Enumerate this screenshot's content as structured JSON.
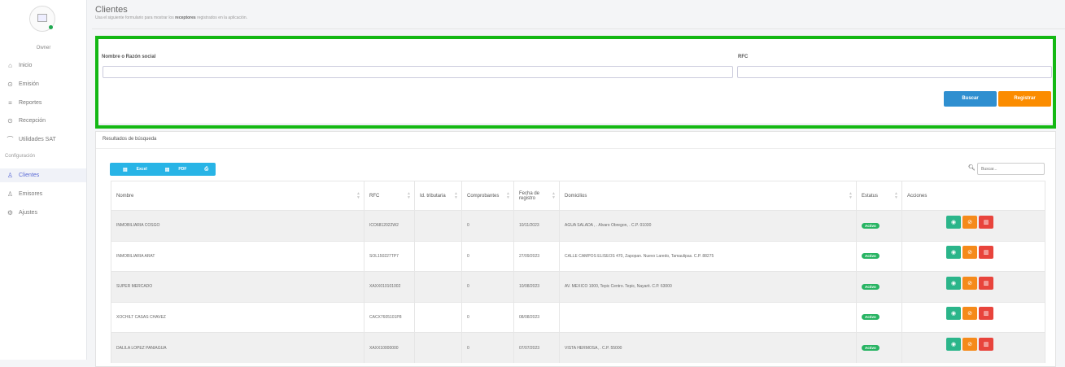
{
  "sidebar": {
    "owner": "Owner",
    "items": [
      {
        "label": "Inicio",
        "icon": "home-icon"
      },
      {
        "label": "Emisión",
        "icon": "emission-icon"
      },
      {
        "label": "Reportes",
        "icon": "list-icon"
      },
      {
        "label": "Recepción",
        "icon": "reception-icon"
      },
      {
        "label": "Utilidades SAT",
        "icon": "utilities-icon"
      }
    ],
    "section_label": "Configuración",
    "config_items": [
      {
        "label": "Clientes",
        "icon": "user-icon",
        "active": true
      },
      {
        "label": "Emisores",
        "icon": "user-icon"
      },
      {
        "label": "Ajustes",
        "icon": "gear-icon"
      }
    ]
  },
  "header": {
    "title": "Clientes",
    "subtitle_pre": "Usa el siguiente formulario para mostrar los ",
    "subtitle_bold": "receptores",
    "subtitle_post": " registrados en la aplicación."
  },
  "search": {
    "name_label": "Nombre o Razón social",
    "rfc_label": "RFC",
    "name_value": "",
    "rfc_value": "",
    "buscar_label": "Buscar",
    "registrar_label": "Registrar"
  },
  "results": {
    "title": "Resultados de búsqueda",
    "export_buttons": [
      "Excel",
      "PDF",
      "Imprimir"
    ],
    "search_placeholder": "Buscar...",
    "columns": [
      "Nombre",
      "RFC",
      "Id. tributaria",
      "Comprobantes",
      "Fecha de registro",
      "Domicilios",
      "Estatus",
      "Acciones"
    ],
    "rows": [
      {
        "nombre": "INMOBILIARIA COSGO",
        "rfc": "ICO6812022W2",
        "id_trib": "",
        "comprobantes": "0",
        "fecha": "10/11/2023",
        "domicilio": "AGUA SALADA , . Alvaro Obregon, . C.P. 01030",
        "estatus": "Activo"
      },
      {
        "nombre": "INMOBILIARIA ARAT",
        "rfc": "SOL150227TP7",
        "id_trib": "",
        "comprobantes": "0",
        "fecha": "27/09/2023",
        "domicilio": "CALLE CAMPOS ELISEOS 470, Zapopan. Nuevo Laredo, Tamaulipas. C.P. 88275",
        "estatus": "Activo"
      },
      {
        "nombre": "SUPER MERCADO",
        "rfc": "XAXX010101002",
        "id_trib": "",
        "comprobantes": "0",
        "fecha": "10/08/2023",
        "domicilio": "AV. MEXICO 1000, Tepic Centro. Tepic, Nayarit. C.P. 63000",
        "estatus": "Activo"
      },
      {
        "nombre": "XOCHILT CASAS CHAVEZ",
        "rfc": "CACX7605101P8",
        "id_trib": "",
        "comprobantes": "0",
        "fecha": "08/08/2023",
        "domicilio": "",
        "estatus": "Activo"
      },
      {
        "nombre": "DALILA LOPEZ PANIAGUA",
        "rfc": "XAXX10000000",
        "id_trib": "",
        "comprobantes": "0",
        "fecha": "07/07/2023",
        "domicilio": "VISTA HERMOSA, . C.P. 55000",
        "estatus": "Activo"
      }
    ]
  },
  "colors": {
    "accent": "#2f8fd0",
    "orange": "#fb8c00",
    "highlight": "#14b814",
    "active_badge": "#28b463"
  }
}
